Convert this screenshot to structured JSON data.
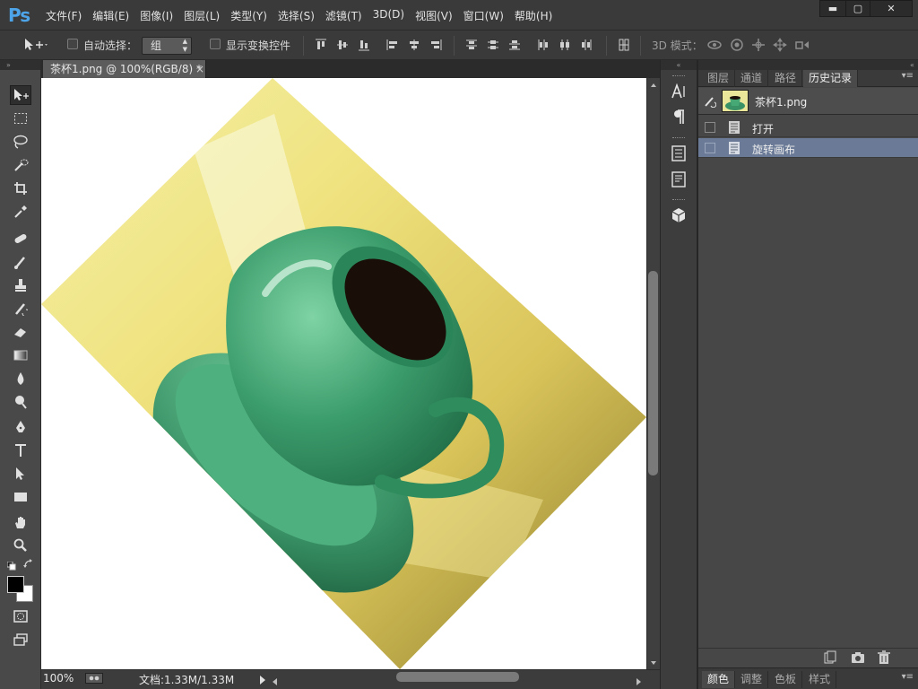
{
  "app": {
    "logo": "Ps"
  },
  "menu": [
    "文件(F)",
    "编辑(E)",
    "图像(I)",
    "图层(L)",
    "类型(Y)",
    "选择(S)",
    "滤镜(T)",
    "3D(D)",
    "视图(V)",
    "窗口(W)",
    "帮助(H)"
  ],
  "window_controls": {
    "minimize": "▬",
    "restore": "▢",
    "close": "✕"
  },
  "options": {
    "auto_select_label": "自动选择：",
    "auto_select_value": "组",
    "show_transform_label": "显示变换控件",
    "mode_3d_label": "3D 模式："
  },
  "tools_header": "»",
  "document": {
    "tab_title": "茶杯1.png @ 100%(RGB/8) *",
    "tab_close": "×",
    "zoom": "100%",
    "doc_info": "文档:1.33M/1.33M"
  },
  "strip_header": "«",
  "history_panel": {
    "header": "«",
    "tabs": [
      "图层",
      "通道",
      "路径",
      "历史记录"
    ],
    "active_tab": "历史记录",
    "menu_icon": "▾≡",
    "snapshot": "茶杯1.png",
    "items": [
      {
        "label": "打开",
        "selected": false
      },
      {
        "label": "旋转画布",
        "selected": true
      }
    ]
  },
  "bottom_panel": {
    "tabs": [
      "颜色",
      "调整",
      "色板",
      "样式"
    ],
    "active_tab": "颜色"
  },
  "colors": {
    "foreground": "#000000",
    "background": "#ffffff",
    "selection": "#6a7a97"
  }
}
